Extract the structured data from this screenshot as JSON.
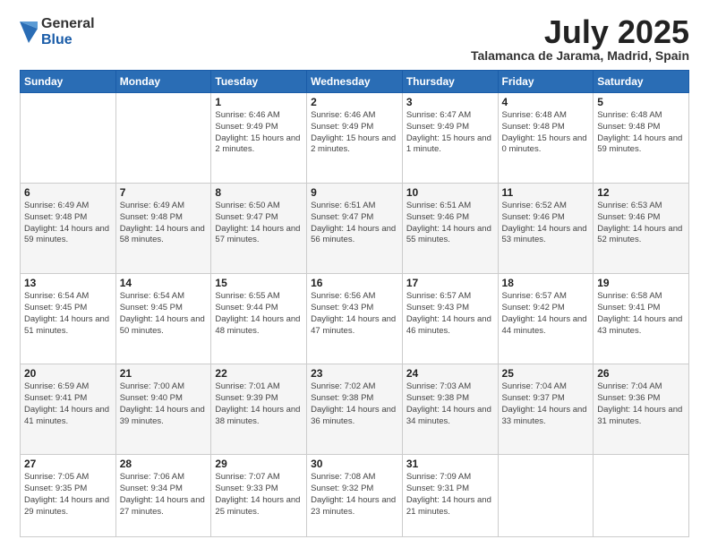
{
  "logo": {
    "general": "General",
    "blue": "Blue"
  },
  "title": {
    "month": "July 2025",
    "location": "Talamanca de Jarama, Madrid, Spain"
  },
  "weekdays": [
    "Sunday",
    "Monday",
    "Tuesday",
    "Wednesday",
    "Thursday",
    "Friday",
    "Saturday"
  ],
  "weeks": [
    [
      {
        "day": "",
        "info": ""
      },
      {
        "day": "",
        "info": ""
      },
      {
        "day": "1",
        "info": "Sunrise: 6:46 AM\nSunset: 9:49 PM\nDaylight: 15 hours\nand 2 minutes."
      },
      {
        "day": "2",
        "info": "Sunrise: 6:46 AM\nSunset: 9:49 PM\nDaylight: 15 hours\nand 2 minutes."
      },
      {
        "day": "3",
        "info": "Sunrise: 6:47 AM\nSunset: 9:49 PM\nDaylight: 15 hours\nand 1 minute."
      },
      {
        "day": "4",
        "info": "Sunrise: 6:48 AM\nSunset: 9:48 PM\nDaylight: 15 hours\nand 0 minutes."
      },
      {
        "day": "5",
        "info": "Sunrise: 6:48 AM\nSunset: 9:48 PM\nDaylight: 14 hours\nand 59 minutes."
      }
    ],
    [
      {
        "day": "6",
        "info": "Sunrise: 6:49 AM\nSunset: 9:48 PM\nDaylight: 14 hours\nand 59 minutes."
      },
      {
        "day": "7",
        "info": "Sunrise: 6:49 AM\nSunset: 9:48 PM\nDaylight: 14 hours\nand 58 minutes."
      },
      {
        "day": "8",
        "info": "Sunrise: 6:50 AM\nSunset: 9:47 PM\nDaylight: 14 hours\nand 57 minutes."
      },
      {
        "day": "9",
        "info": "Sunrise: 6:51 AM\nSunset: 9:47 PM\nDaylight: 14 hours\nand 56 minutes."
      },
      {
        "day": "10",
        "info": "Sunrise: 6:51 AM\nSunset: 9:46 PM\nDaylight: 14 hours\nand 55 minutes."
      },
      {
        "day": "11",
        "info": "Sunrise: 6:52 AM\nSunset: 9:46 PM\nDaylight: 14 hours\nand 53 minutes."
      },
      {
        "day": "12",
        "info": "Sunrise: 6:53 AM\nSunset: 9:46 PM\nDaylight: 14 hours\nand 52 minutes."
      }
    ],
    [
      {
        "day": "13",
        "info": "Sunrise: 6:54 AM\nSunset: 9:45 PM\nDaylight: 14 hours\nand 51 minutes."
      },
      {
        "day": "14",
        "info": "Sunrise: 6:54 AM\nSunset: 9:45 PM\nDaylight: 14 hours\nand 50 minutes."
      },
      {
        "day": "15",
        "info": "Sunrise: 6:55 AM\nSunset: 9:44 PM\nDaylight: 14 hours\nand 48 minutes."
      },
      {
        "day": "16",
        "info": "Sunrise: 6:56 AM\nSunset: 9:43 PM\nDaylight: 14 hours\nand 47 minutes."
      },
      {
        "day": "17",
        "info": "Sunrise: 6:57 AM\nSunset: 9:43 PM\nDaylight: 14 hours\nand 46 minutes."
      },
      {
        "day": "18",
        "info": "Sunrise: 6:57 AM\nSunset: 9:42 PM\nDaylight: 14 hours\nand 44 minutes."
      },
      {
        "day": "19",
        "info": "Sunrise: 6:58 AM\nSunset: 9:41 PM\nDaylight: 14 hours\nand 43 minutes."
      }
    ],
    [
      {
        "day": "20",
        "info": "Sunrise: 6:59 AM\nSunset: 9:41 PM\nDaylight: 14 hours\nand 41 minutes."
      },
      {
        "day": "21",
        "info": "Sunrise: 7:00 AM\nSunset: 9:40 PM\nDaylight: 14 hours\nand 39 minutes."
      },
      {
        "day": "22",
        "info": "Sunrise: 7:01 AM\nSunset: 9:39 PM\nDaylight: 14 hours\nand 38 minutes."
      },
      {
        "day": "23",
        "info": "Sunrise: 7:02 AM\nSunset: 9:38 PM\nDaylight: 14 hours\nand 36 minutes."
      },
      {
        "day": "24",
        "info": "Sunrise: 7:03 AM\nSunset: 9:38 PM\nDaylight: 14 hours\nand 34 minutes."
      },
      {
        "day": "25",
        "info": "Sunrise: 7:04 AM\nSunset: 9:37 PM\nDaylight: 14 hours\nand 33 minutes."
      },
      {
        "day": "26",
        "info": "Sunrise: 7:04 AM\nSunset: 9:36 PM\nDaylight: 14 hours\nand 31 minutes."
      }
    ],
    [
      {
        "day": "27",
        "info": "Sunrise: 7:05 AM\nSunset: 9:35 PM\nDaylight: 14 hours\nand 29 minutes."
      },
      {
        "day": "28",
        "info": "Sunrise: 7:06 AM\nSunset: 9:34 PM\nDaylight: 14 hours\nand 27 minutes."
      },
      {
        "day": "29",
        "info": "Sunrise: 7:07 AM\nSunset: 9:33 PM\nDaylight: 14 hours\nand 25 minutes."
      },
      {
        "day": "30",
        "info": "Sunrise: 7:08 AM\nSunset: 9:32 PM\nDaylight: 14 hours\nand 23 minutes."
      },
      {
        "day": "31",
        "info": "Sunrise: 7:09 AM\nSunset: 9:31 PM\nDaylight: 14 hours\nand 21 minutes."
      },
      {
        "day": "",
        "info": ""
      },
      {
        "day": "",
        "info": ""
      }
    ]
  ]
}
